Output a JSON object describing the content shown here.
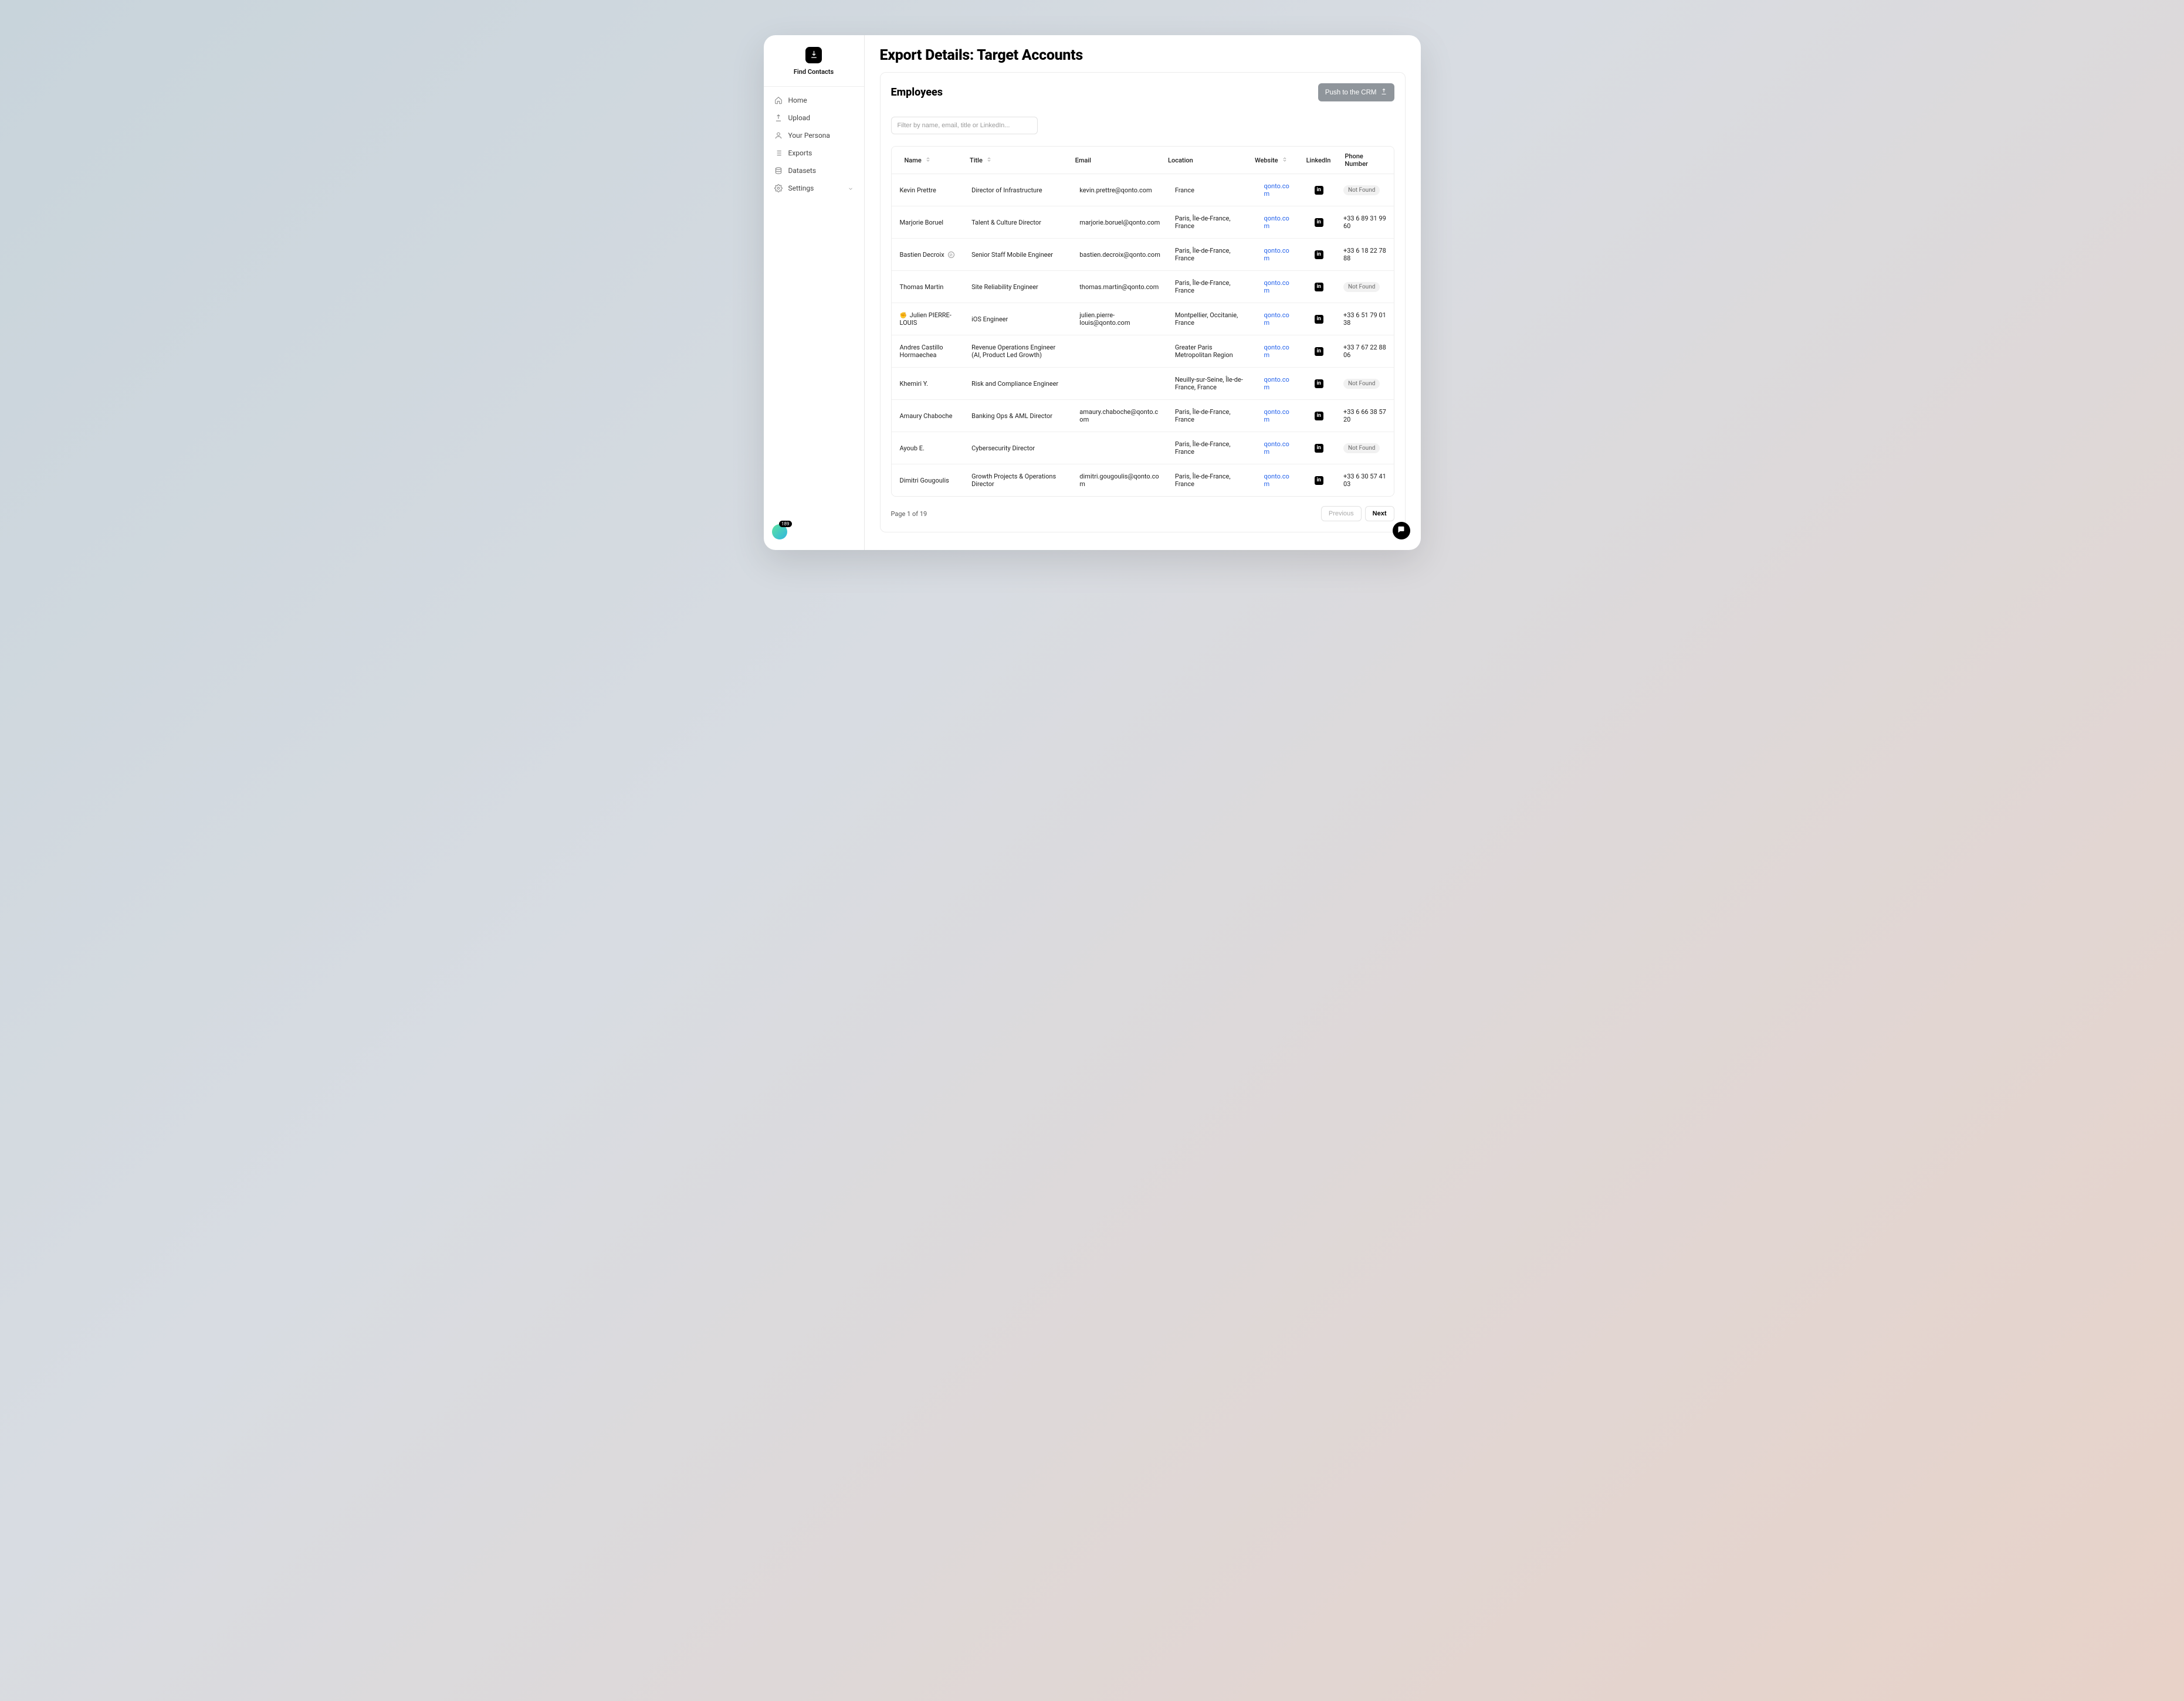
{
  "brand": "Find Contacts",
  "sidebar": {
    "items": [
      {
        "label": "Home",
        "icon": "home"
      },
      {
        "label": "Upload",
        "icon": "upload"
      },
      {
        "label": "Your Persona",
        "icon": "user"
      },
      {
        "label": "Exports",
        "icon": "list"
      },
      {
        "label": "Datasets",
        "icon": "database"
      },
      {
        "label": "Settings",
        "icon": "gear",
        "chevron": true
      }
    ]
  },
  "page_title": "Export Details: Target Accounts",
  "card": {
    "title": "Employees",
    "push_label": "Push to the CRM",
    "filter_placeholder": "Filter by name, email, title or LinkedIn..."
  },
  "columns": {
    "name": "Name",
    "title": "Title",
    "email": "Email",
    "location": "Location",
    "website": "Website",
    "linkedin": "LinkedIn",
    "phone": "Phone Number"
  },
  "not_found_label": "Not Found",
  "rows": [
    {
      "name": "Kevin Prettre",
      "title": "Director of Infrastructure",
      "email": "kevin.prettre@qonto.com",
      "location": "France",
      "website": "qonto.com",
      "phone": ""
    },
    {
      "name": "Marjorie Boruel",
      "title": "Talent & Culture Director",
      "email": "marjorie.boruel@qonto.com",
      "location": "Paris, Île-de-France, France",
      "website": "qonto.com",
      "phone": "+33 6 89 31 99 60"
    },
    {
      "name": "Bastien Decroix",
      "name_suffix": "⊘",
      "title": "Senior Staff Mobile Engineer",
      "email": "bastien.decroix@qonto.com",
      "location": "Paris, Île-de-France, France",
      "website": "qonto.com",
      "phone": "+33 6 18 22 78 88"
    },
    {
      "name": "Thomas Martin",
      "title": "Site Reliability Engineer",
      "email": "thomas.martin@qonto.com",
      "location": "Paris, Île-de-France, France",
      "website": "qonto.com",
      "phone": ""
    },
    {
      "name": "Julien PIERRE-LOUIS",
      "name_prefix": "✊",
      "title": "iOS Engineer",
      "email": "julien.pierre-louis@qonto.com",
      "location": "Montpellier, Occitanie, France",
      "website": "qonto.com",
      "phone": "+33 6 51 79 01 38"
    },
    {
      "name": "Andres Castillo Hormaechea",
      "title": "Revenue Operations Engineer (AI, Product Led Growth)",
      "email": "",
      "location": "Greater Paris Metropolitan Region",
      "website": "qonto.com",
      "phone": "+33 7 67 22 88 06"
    },
    {
      "name": "Khemiri Y.",
      "title": "Risk and Compliance Engineer",
      "email": "",
      "location": "Neuilly-sur-Seine, Île-de-France, France",
      "website": "qonto.com",
      "phone": ""
    },
    {
      "name": "Amaury Chaboche",
      "title": "Banking Ops & AML Director",
      "email": "amaury.chaboche@qonto.com",
      "location": "Paris, Île-de-France, France",
      "website": "qonto.com",
      "phone": "+33 6 66 38 57 20"
    },
    {
      "name": "Ayoub E.",
      "title": "Cybersecurity Director",
      "email": "",
      "location": "Paris, Île-de-France, France",
      "website": "qonto.com",
      "phone": ""
    },
    {
      "name": "Dimitri Gougoulis",
      "title": "Growth Projects & Operations Director",
      "email": "dimitri.gougoulis@qonto.com",
      "location": "Paris, Île-de-France, France",
      "website": "qonto.com",
      "phone": "+33 6 30 57 41 03"
    }
  ],
  "footer": {
    "page_info": "Page 1 of 19",
    "prev": "Previous",
    "next": "Next"
  },
  "status_count": "189"
}
